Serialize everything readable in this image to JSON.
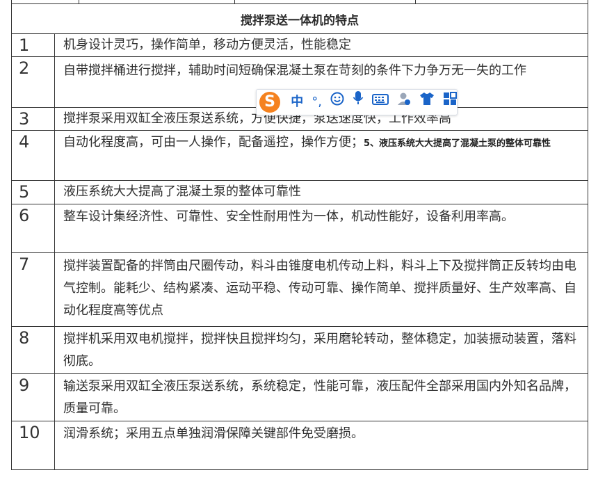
{
  "table": {
    "title": "搅拌泵送一体机的特点",
    "rows": [
      {
        "num": "1",
        "text": "机身设计灵巧，操作简单，移动方便灵活，性能稳定"
      },
      {
        "num": "2",
        "text": "自带搅拌桶进行搅拌，辅助时间短确保混凝土泵在苛刻的条件下力争万无一失的工作"
      },
      {
        "num": "3",
        "text": "搅拌泵采用双缸全液压泵送系统，方便快捷，泵送速度快，工作效率高"
      },
      {
        "num": "4",
        "text": "自动化程度高，可由一人操作，配备遥控，操作方便；",
        "extra": "5、液压系统大大提高了混凝土泵的整体可靠性"
      },
      {
        "num": "5",
        "text": "液压系统大大提高了混凝土泵的整体可靠性"
      },
      {
        "num": "6",
        "text": "整车设计集经济性、可靠性、安全性耐用性为一体，机动性能好，设备利用率高。"
      },
      {
        "num": "7",
        "text": "搅拌装置配备的拌筒由尺圈传动，料斗由锥度电机传动上料，料斗上下及搅拌筒正反转均由电气控制。能耗少、结构紧凑、运动平稳、传动可靠、操作简单、搅拌质量好、生产效率高、自动化程度高等优点"
      },
      {
        "num": "8",
        "text": "搅拌机采用双电机搅拌，搅拌快且搅拌均匀，采用磨轮转动，整体稳定，加装振动装置，落料彻底。"
      },
      {
        "num": "9",
        "text": "输送泵采用双缸全液压泵送系统，系统稳定，性能可靠，液压配件全部采用国内外知名品牌，质量可靠。"
      },
      {
        "num": "10",
        "text": "润滑系统；采用五点单独润滑保障关键部件免受磨损。"
      }
    ]
  },
  "ime_toolbar": {
    "logo": "S",
    "mode": "中",
    "punct": "°,",
    "icons": [
      "smiley-icon",
      "microphone-icon",
      "keyboard-icon",
      "user-icon",
      "shirt-icon",
      "grid-icon"
    ],
    "accent": "#1a64c8",
    "logo_color": "#f5821f"
  }
}
